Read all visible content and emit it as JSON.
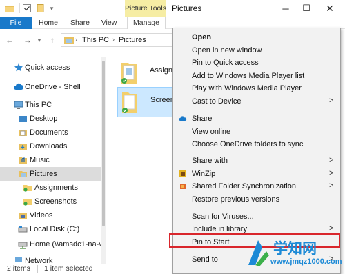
{
  "window": {
    "title": "Pictures",
    "contextual_tab_group": "Picture Tools"
  },
  "ribbon": {
    "tabs": [
      "File",
      "Home",
      "Share",
      "View",
      "Manage"
    ]
  },
  "address": {
    "crumbs": [
      "This PC",
      "Pictures"
    ]
  },
  "sidebar": {
    "items": [
      {
        "label": "Quick access",
        "icon": "star-icon"
      },
      {
        "label": "OneDrive - Shell",
        "icon": "cloud-icon"
      },
      {
        "label": "This PC",
        "icon": "computer-icon"
      },
      {
        "label": "Desktop",
        "icon": "folder-icon"
      },
      {
        "label": "Documents",
        "icon": "folder-icon"
      },
      {
        "label": "Downloads",
        "icon": "folder-icon"
      },
      {
        "label": "Music",
        "icon": "folder-icon"
      },
      {
        "label": "Pictures",
        "icon": "folder-icon"
      },
      {
        "label": "Assignments",
        "icon": "folder-icon"
      },
      {
        "label": "Screenshots",
        "icon": "folder-icon"
      },
      {
        "label": "Videos",
        "icon": "folder-icon"
      },
      {
        "label": "Local Disk (C:)",
        "icon": "drive-icon"
      },
      {
        "label": "Home (\\\\amsdc1-na-v",
        "icon": "network-drive-icon"
      },
      {
        "label": "Network",
        "icon": "network-icon"
      }
    ]
  },
  "content": {
    "tiles": [
      {
        "label": "Assign",
        "selected": false
      },
      {
        "label": "Screen",
        "selected": true
      }
    ]
  },
  "status": {
    "count": "2 items",
    "selection": "1 item selected"
  },
  "context_menu": {
    "items": [
      {
        "label": "Open",
        "bold": true
      },
      {
        "label": "Open in new window"
      },
      {
        "label": "Pin to Quick access"
      },
      {
        "label": "Add to Windows Media Player list"
      },
      {
        "label": "Play with Windows Media Player"
      },
      {
        "label": "Cast to Device",
        "submenu": true
      },
      {
        "label": "Share",
        "icon": "onedrive-share-icon"
      },
      {
        "label": "View online"
      },
      {
        "label": "Choose OneDrive folders to sync"
      },
      {
        "label": "Share with",
        "submenu": true
      },
      {
        "label": "WinZip",
        "icon": "winzip-icon",
        "submenu": true
      },
      {
        "label": "Shared Folder Synchronization",
        "icon": "sync-icon",
        "submenu": true
      },
      {
        "label": "Restore previous versions"
      },
      {
        "label": "Scan for Viruses..."
      },
      {
        "label": "Include in library",
        "submenu": true
      },
      {
        "label": "Pin to Start",
        "highlighted": true
      },
      {
        "label": "Send to",
        "submenu": true
      }
    ]
  },
  "watermark": {
    "text": "学知网",
    "url": "www.jmqz1000.com"
  },
  "colors": {
    "accent": "#1979ca",
    "contextual_tab": "#f6eda4",
    "highlight_border": "#d9262c",
    "selection": "#cce8ff"
  }
}
